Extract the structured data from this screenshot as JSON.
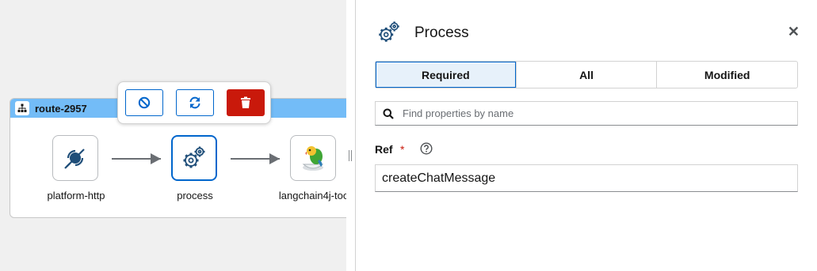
{
  "canvas": {
    "route": {
      "title": "route-2957"
    },
    "nodes": [
      {
        "label": "platform-http",
        "icon": "disconnected-plug-icon"
      },
      {
        "label": "process",
        "icon": "gears-icon"
      },
      {
        "label": "langchain4j-too",
        "icon": "parrot-icon"
      }
    ],
    "toolbar": {
      "disable_icon": "ban-icon",
      "reload_icon": "sync-icon",
      "delete_icon": "trash-icon"
    },
    "colors": {
      "accent": "#0066cc",
      "route_header": "#73bcf7",
      "danger": "#c9190b"
    }
  },
  "panel": {
    "title": "Process",
    "tabs": [
      {
        "label": "Required",
        "active": true
      },
      {
        "label": "All",
        "active": false
      },
      {
        "label": "Modified",
        "active": false
      }
    ],
    "search": {
      "placeholder": "Find properties by name"
    },
    "field": {
      "label": "Ref",
      "required_marker": "*",
      "value": "createChatMessage"
    }
  }
}
